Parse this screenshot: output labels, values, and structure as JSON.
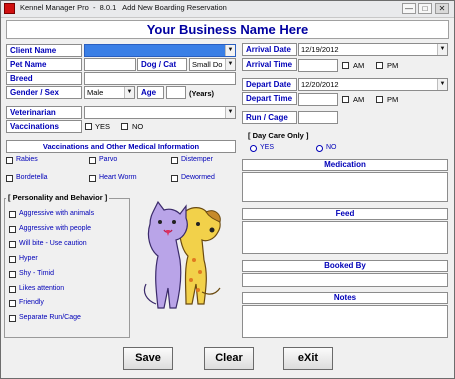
{
  "window": {
    "title": "Kennel Manager Pro  -  8.0.1   Add New Boarding Reservation",
    "controls": {
      "minimize": "—",
      "restore": "□",
      "close": "✕"
    }
  },
  "business_name": "Your Business Name Here",
  "client": {
    "client_name_label": "Client Name",
    "pet_name_label": "Pet Name",
    "dog_cat_label": "Dog / Cat",
    "size_value": "Small Do",
    "breed_label": "Breed",
    "gender_sex_label": "Gender / Sex",
    "gender_value": "Male",
    "age_label": "Age",
    "years_label": "(Years)",
    "veterinarian_label": "Veterinarian",
    "vaccinations_label": "Vaccinations",
    "yes_label": "YES",
    "no_label": "NO"
  },
  "vaccinations": {
    "title": "Vaccinations and Other Medical Information",
    "items": [
      "Rabies",
      "Parvo",
      "Distemper",
      "Bordetella",
      "Heart Worm",
      "Dewormed"
    ]
  },
  "personality": {
    "title": "[ Personality and Behavior ]",
    "items": [
      "Aggressive with animals",
      "Aggressive with people",
      "Will bite - Use caution",
      "Hyper",
      "Shy - Timid",
      "Likes attention",
      "Friendly",
      "Separate Run/Cage"
    ]
  },
  "reservation": {
    "arrival_date_label": "Arrival Date",
    "arrival_date_value": "12/19/2012",
    "arrival_time_label": "Arrival Time",
    "depart_date_label": "Depart Date",
    "depart_date_value": "12/20/2012",
    "depart_time_label": "Depart Time",
    "am_label": "AM",
    "pm_label": "PM",
    "run_cage_label": "Run / Cage"
  },
  "day_care": {
    "title": "[ Day  Care  Only ]",
    "yes_label": "YES",
    "no_label": "NO"
  },
  "sections": {
    "medication": "Medication",
    "feed": "Feed",
    "booked_by": "Booked By",
    "notes": "Notes"
  },
  "buttons": {
    "save": "Save",
    "clear": "Clear",
    "exit": "eXit"
  }
}
